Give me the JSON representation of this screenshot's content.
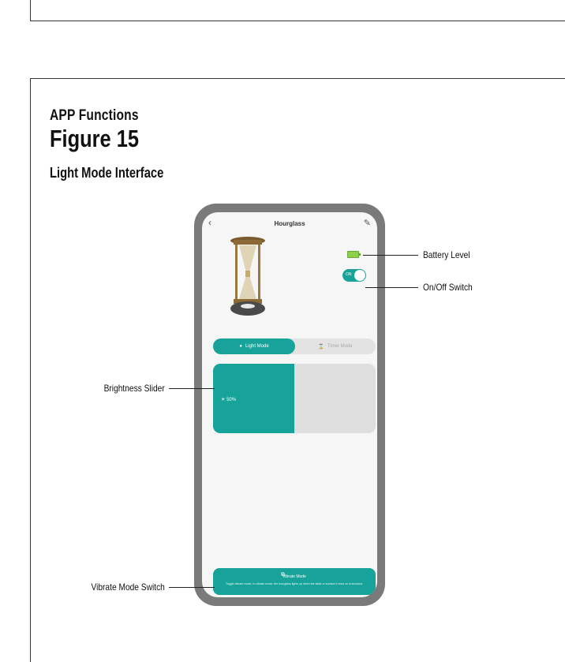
{
  "doc": {
    "section": "APP Functions",
    "figure": "Figure 15",
    "caption": "Light Mode Interface"
  },
  "screen": {
    "title": "Hourglass",
    "back_icon": "chevron-left-icon",
    "edit_icon": "pencil-icon",
    "toggle_state": "ON",
    "tabs": [
      {
        "label": "Light Mode",
        "icon": "lightbulb-icon",
        "active": true
      },
      {
        "label": "Timer Mode",
        "icon": "hourglass-icon",
        "active": false
      }
    ],
    "brightness": {
      "label": "50%",
      "value": 0.5
    },
    "vibrate": {
      "title": "Vibrate Mode",
      "description": "Toggle vibrate mode. In vibrate mode, the hourglass lights up when the table or surface it rests on is knocked."
    },
    "accent_color": "#17a39a"
  },
  "callouts": {
    "battery": "Battery Level",
    "switch": "On/Off Switch",
    "slider": "Brightness Slider",
    "vibrate": "Vibrate Mode Switch"
  }
}
